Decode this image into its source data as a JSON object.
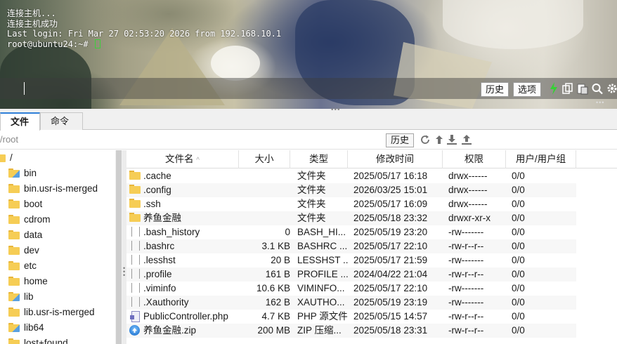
{
  "terminal": {
    "lines": [
      "连接主机...",
      "连接主机成功",
      "Last login: Fri Mar 27 02:53:20 2026 from 192.168.10.1",
      "root@ubuntu24:~# "
    ],
    "history_button": "历史",
    "options_button": "选项"
  },
  "tabs": {
    "files": "文件",
    "commands": "命令"
  },
  "pathbar": {
    "path": "/root",
    "history_button": "历史"
  },
  "tree": {
    "items": [
      "/",
      "bin",
      "bin.usr-is-merged",
      "boot",
      "cdrom",
      "data",
      "dev",
      "etc",
      "home",
      "lib",
      "lib.usr-is-merged",
      "lib64",
      "lost+found"
    ]
  },
  "filelist": {
    "headers": {
      "name": "文件名",
      "size": "大小",
      "type": "类型",
      "mtime": "修改时间",
      "perm": "权限",
      "owner": "用户/用户组"
    },
    "sort_indicator": "^",
    "rows": [
      {
        "name": ".cache",
        "size": "",
        "type": "文件夹",
        "mtime": "2025/05/17 16:18",
        "perm": "drwx------",
        "owner": "0/0",
        "icon": "folder"
      },
      {
        "name": ".config",
        "size": "",
        "type": "文件夹",
        "mtime": "2026/03/25 15:01",
        "perm": "drwx------",
        "owner": "0/0",
        "icon": "folder"
      },
      {
        "name": ".ssh",
        "size": "",
        "type": "文件夹",
        "mtime": "2025/05/17 16:09",
        "perm": "drwx------",
        "owner": "0/0",
        "icon": "folder"
      },
      {
        "name": "养鱼金融",
        "size": "",
        "type": "文件夹",
        "mtime": "2025/05/18 23:32",
        "perm": "drwxr-xr-x",
        "owner": "0/0",
        "icon": "folder"
      },
      {
        "name": ".bash_history",
        "size": "0",
        "type": "BASH_HI...",
        "mtime": "2025/05/19 23:20",
        "perm": "-rw-------",
        "owner": "0/0",
        "icon": "file"
      },
      {
        "name": ".bashrc",
        "size": "3.1 KB",
        "type": "BASHRC ...",
        "mtime": "2025/05/17 22:10",
        "perm": "-rw-r--r--",
        "owner": "0/0",
        "icon": "file"
      },
      {
        "name": ".lesshst",
        "size": "20 B",
        "type": "LESSHST ...",
        "mtime": "2025/05/17 21:59",
        "perm": "-rw-------",
        "owner": "0/0",
        "icon": "file"
      },
      {
        "name": ".profile",
        "size": "161 B",
        "type": "PROFILE ...",
        "mtime": "2024/04/22 21:04",
        "perm": "-rw-r--r--",
        "owner": "0/0",
        "icon": "file"
      },
      {
        "name": ".viminfo",
        "size": "10.6 KB",
        "type": "VIMINFO...",
        "mtime": "2025/05/17 22:10",
        "perm": "-rw-------",
        "owner": "0/0",
        "icon": "file"
      },
      {
        "name": ".Xauthority",
        "size": "162 B",
        "type": "XAUTHO...",
        "mtime": "2025/05/19 23:19",
        "perm": "-rw-------",
        "owner": "0/0",
        "icon": "file"
      },
      {
        "name": "PublicController.php",
        "size": "4.7 KB",
        "type": "PHP 源文件",
        "mtime": "2025/05/15 14:57",
        "perm": "-rw-r--r--",
        "owner": "0/0",
        "icon": "php"
      },
      {
        "name": "养鱼金融.zip",
        "size": "200 MB",
        "type": "ZIP 压缩...",
        "mtime": "2025/05/18 23:31",
        "perm": "-rw-r--r--",
        "owner": "0/0",
        "icon": "zip"
      }
    ]
  },
  "colors": {
    "accent": "#2f7fd8",
    "cursor": "#3cd03c",
    "folder": "#f6cd55"
  }
}
